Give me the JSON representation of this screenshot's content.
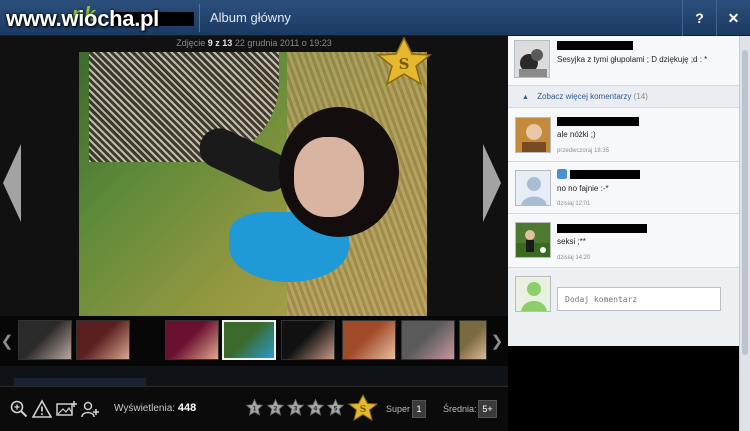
{
  "header": {
    "site_watermark": "www.wiocha.pl",
    "logo": "nk",
    "title": "Album główny",
    "help_label": "?",
    "close_label": "✕"
  },
  "photo": {
    "label": "Zdjęcie",
    "index": "9 z 13",
    "date": "22 grudnia 2011 o 19:23",
    "badge_letter": "S"
  },
  "filmstrip": {
    "prev": "❮",
    "next": "❯",
    "thumbs": [
      {
        "colors": [
          "#2a2a2a",
          "#bba8a0"
        ]
      },
      {
        "colors": [
          "#5a1f1f",
          "#d8a692"
        ]
      },
      {
        "colors": [
          "#6a1030",
          "#e0a890"
        ]
      },
      {
        "colors": [
          "#3b6a2a",
          "#2a9ad2"
        ],
        "active": true
      },
      {
        "colors": [
          "#111111",
          "#c89a88"
        ]
      },
      {
        "colors": [
          "#a04a2a",
          "#e8c0a0"
        ]
      },
      {
        "colors": [
          "#5a5a5a",
          "#c898a0"
        ]
      },
      {
        "colors": [
          "#7a6a40",
          "#d8b898"
        ]
      }
    ]
  },
  "toolbar": {
    "icons": [
      "zoom-icon",
      "report-icon",
      "add-photo-icon",
      "tag-person-icon"
    ],
    "views_label": "Wyświetlenia:",
    "views_value": "448",
    "rating_stars": [
      "1",
      "2",
      "3",
      "4",
      "5"
    ],
    "super_badge": "S",
    "super_label": "Super",
    "super_value": "1",
    "avg_label": "Średnia:",
    "avg_value": "5+"
  },
  "comments_panel": {
    "owner_comment": {
      "text": "Sesyjka z tymi głupolami ; D dziękuję ;d : *"
    },
    "more_comments": {
      "label": "Zobacz więcej komentarzy",
      "count": "(14)"
    },
    "comments": [
      {
        "text": "ale nóżki ;)",
        "date": "przedwczoraj 18:35"
      },
      {
        "text": "no no fajnie :-*",
        "date": "dzisiaj 12:01"
      },
      {
        "text": "seksi ;**",
        "date": "dzisiaj 14:20"
      }
    ],
    "input_placeholder": "Dodaj komentarz"
  },
  "colors": {
    "header_bg": "#244770",
    "panel_bg": "#eef0f3",
    "link": "#2c5b95"
  }
}
